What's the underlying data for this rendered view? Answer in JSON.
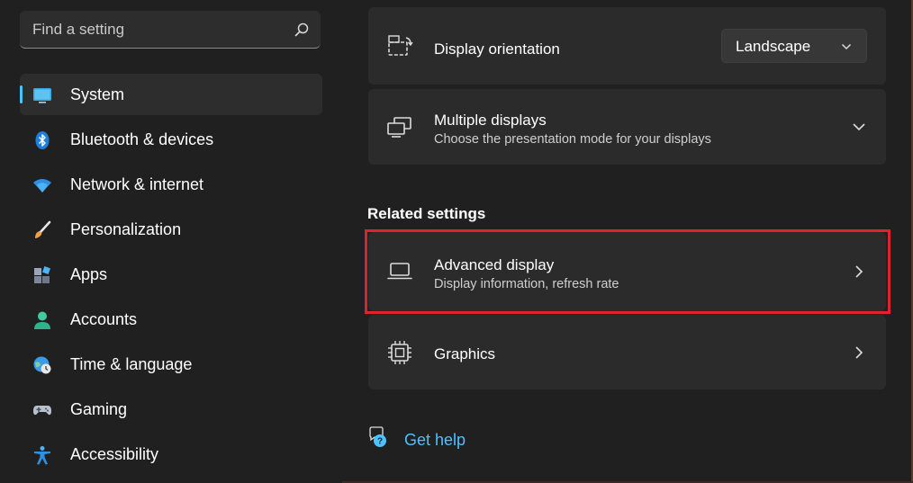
{
  "search": {
    "placeholder": "Find a setting",
    "icon": "search-icon"
  },
  "sidebar": {
    "accent_color": "#4cc2ff",
    "items": [
      {
        "label": "System",
        "icon": "monitor-icon",
        "active": true
      },
      {
        "label": "Bluetooth & devices",
        "icon": "bluetooth-icon",
        "active": false
      },
      {
        "label": "Network & internet",
        "icon": "wifi-icon",
        "active": false
      },
      {
        "label": "Personalization",
        "icon": "paintbrush-icon",
        "active": false
      },
      {
        "label": "Apps",
        "icon": "apps-icon",
        "active": false
      },
      {
        "label": "Accounts",
        "icon": "person-icon",
        "active": false
      },
      {
        "label": "Time & language",
        "icon": "globe-clock-icon",
        "active": false
      },
      {
        "label": "Gaming",
        "icon": "gamepad-icon",
        "active": false
      },
      {
        "label": "Accessibility",
        "icon": "accessibility-icon",
        "active": false
      }
    ]
  },
  "main": {
    "orientation": {
      "title": "Display orientation",
      "value": "Landscape",
      "icon": "rotate-screen-icon"
    },
    "multiple_displays": {
      "title": "Multiple displays",
      "subtitle": "Choose the presentation mode for your displays",
      "icon": "multiple-displays-icon"
    },
    "related_heading": "Related settings",
    "advanced_display": {
      "title": "Advanced display",
      "subtitle": "Display information, refresh rate",
      "icon": "laptop-icon"
    },
    "graphics": {
      "title": "Graphics",
      "icon": "chip-icon"
    },
    "help": {
      "label": "Get help",
      "icon": "help-chat-icon"
    },
    "highlight_color": "#e0222e",
    "link_color": "#4cc2ff"
  }
}
